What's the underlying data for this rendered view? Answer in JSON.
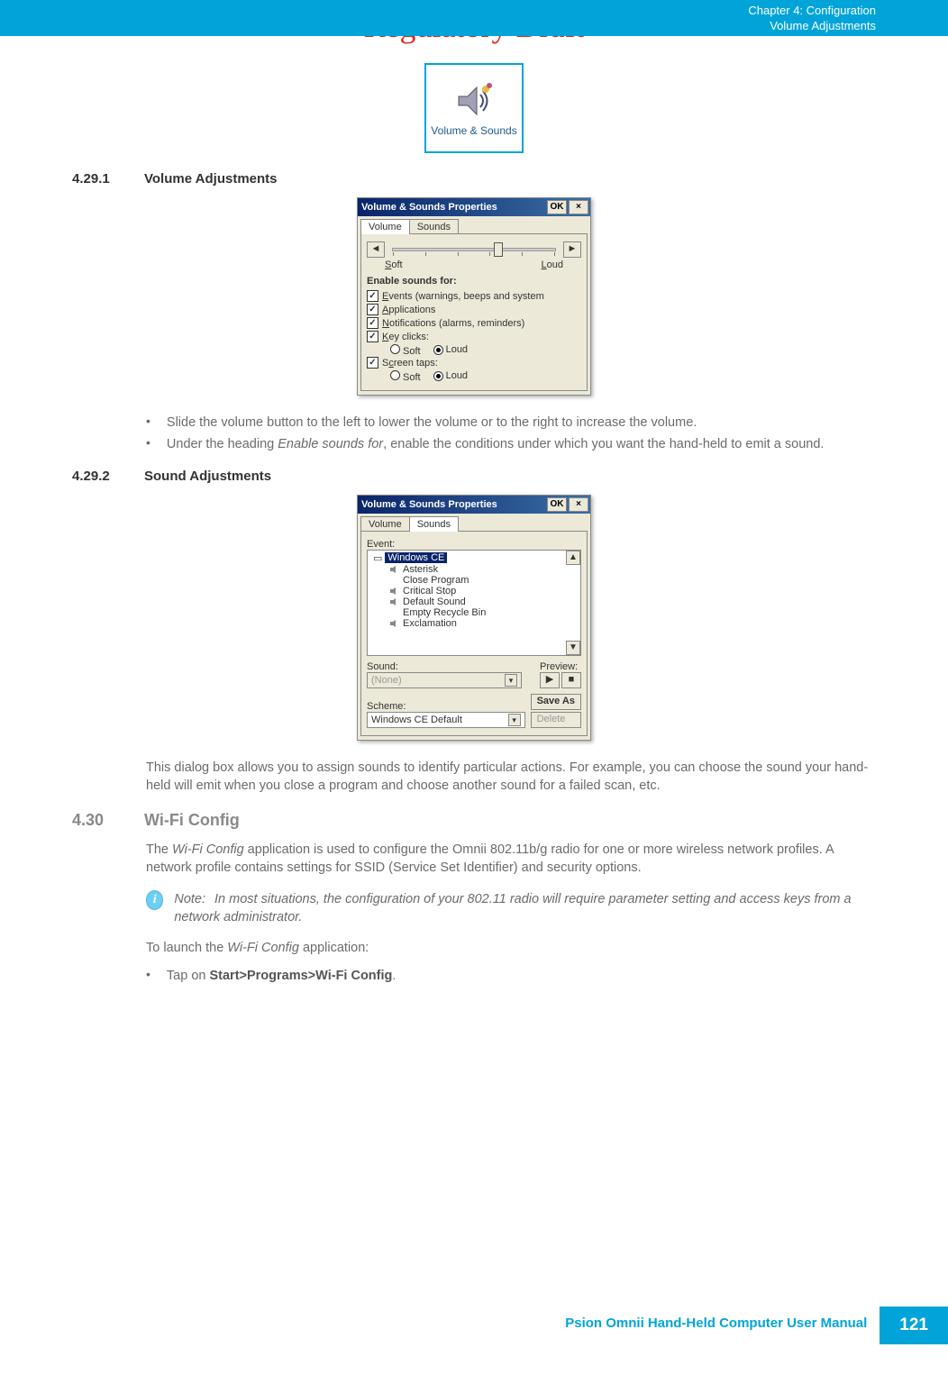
{
  "watermark": "Regulatory Draft",
  "header": {
    "chapter": "Chapter 4:  Configuration",
    "subtitle": "Volume Adjustments"
  },
  "volume_icon": {
    "label": "Volume & Sounds"
  },
  "section_4_29_1": {
    "num": "4.29.1",
    "title": "Volume Adjustments"
  },
  "dialog1": {
    "title": "Volume & Sounds Properties",
    "ok": "OK",
    "tab_volume": "Volume",
    "tab_sounds": "Sounds",
    "soft": "Soft",
    "loud": "Loud",
    "enable_heading": "Enable sounds for:",
    "chk_events": "Events (warnings, beeps and system",
    "chk_apps": "Applications",
    "chk_notif": "Notifications (alarms, reminders)",
    "chk_key": "Key clicks:",
    "chk_screen": "Screen taps:",
    "radio_soft": "Soft",
    "radio_loud": "Loud"
  },
  "bullets_1": {
    "b1": "Slide the volume button to the left to lower the volume or to the right to increase the volume.",
    "b2a": "Under the heading ",
    "b2b": "Enable sounds for",
    "b2c": ", enable the conditions under which you want the hand-held to emit a sound."
  },
  "section_4_29_2": {
    "num": "4.29.2",
    "title": "Sound Adjustments"
  },
  "dialog2": {
    "title": "Volume & Sounds Properties",
    "ok": "OK",
    "tab_volume": "Volume",
    "tab_sounds": "Sounds",
    "event_label": "Event:",
    "root": "Windows CE",
    "items": [
      "Asterisk",
      "Close Program",
      "Critical Stop",
      "Default Sound",
      "Empty Recycle Bin",
      "Exclamation"
    ],
    "sound_label": "Sound:",
    "sound_value": "(None)",
    "preview_label": "Preview:",
    "scheme_label": "Scheme:",
    "scheme_value": "Windows CE Default",
    "save_as": "Save As",
    "delete": "Delete"
  },
  "para_sounds": "This dialog box allows you to assign sounds to identify particular actions. For example, you can choose the sound your hand-held will emit when you close a program and choose another sound for a failed scan, etc.",
  "section_4_30": {
    "num": "4.30",
    "title": "Wi-Fi Config"
  },
  "wifi_para_a": "The ",
  "wifi_para_b": "Wi-Fi Config",
  "wifi_para_c": " application is used to configure the Omnii 802.11b/g radio for one or more wireless network profiles. A network profile contains settings for SSID (Service Set Identifier) and security options.",
  "note": {
    "label": "Note:",
    "text": "In most situations, the configuration of your 802.11 radio will require parameter setting and access keys from a network administrator."
  },
  "launch_a": "To launch the ",
  "launch_b": "Wi-Fi Config",
  "launch_c": " application:",
  "bullet_launch_a": "Tap on ",
  "bullet_launch_b": "Start>Programs>Wi-Fi Config",
  "bullet_launch_c": ".",
  "footer": {
    "text": "Psion Omnii Hand-Held Computer User Manual",
    "page": "121"
  }
}
